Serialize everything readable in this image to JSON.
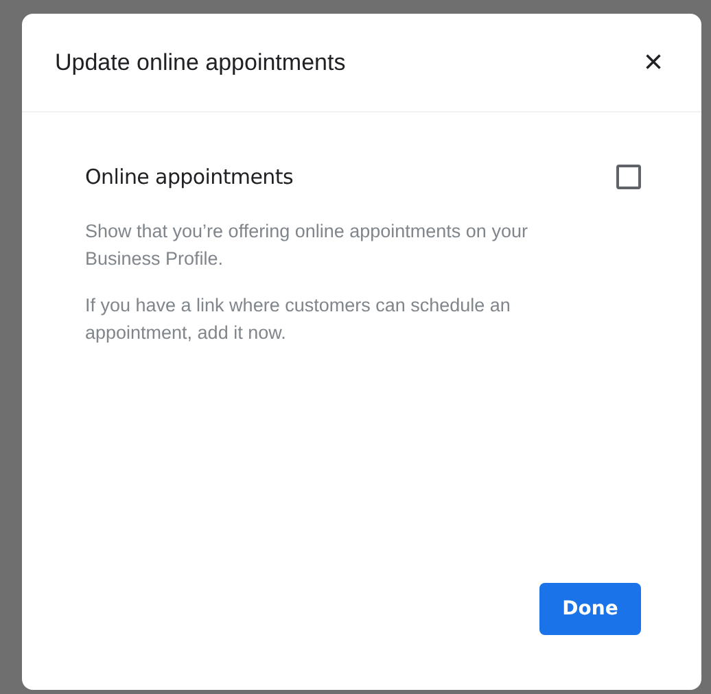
{
  "dialog": {
    "title": "Update online appointments",
    "close": "×",
    "option": {
      "label": "Online appointments",
      "checked": false
    },
    "paragraphs": [
      "Show that you’re offering online appointments on your Business Profile.",
      "If you have a link where customers can schedule an appointment, add it now."
    ],
    "buttons": [
      "Done"
    ]
  }
}
